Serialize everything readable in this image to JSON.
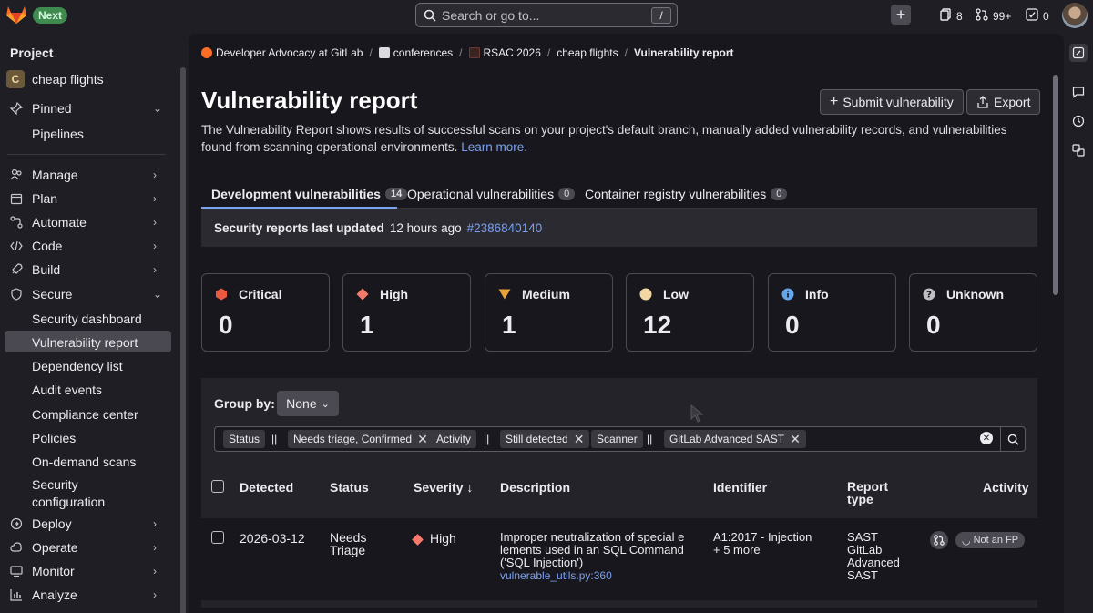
{
  "topbar": {
    "next_badge": "Next",
    "search_placeholder": "Search or go to...",
    "search_shortcut": "/",
    "snippets_count": "8",
    "merge_requests_count": "99+",
    "todos_count": "0"
  },
  "sidebar": {
    "heading": "Project",
    "project_initial": "C",
    "project_name": "cheap flights",
    "pinned": "Pinned",
    "pinned_items": [
      "Pipelines"
    ],
    "manage": "Manage",
    "plan": "Plan",
    "automate": "Automate",
    "code": "Code",
    "build": "Build",
    "secure": "Secure",
    "secure_items": [
      "Security dashboard",
      "Vulnerability report",
      "Dependency list",
      "Audit events",
      "Compliance center",
      "Policies",
      "On-demand scans",
      "Security",
      "configuration"
    ],
    "deploy": "Deploy",
    "operate": "Operate",
    "monitor": "Monitor",
    "analyze": "Analyze"
  },
  "breadcrumb": {
    "items": [
      "Developer Advocacy at GitLab",
      "conferences",
      "RSAC 2026",
      "cheap flights"
    ],
    "current": "Vulnerability report"
  },
  "page": {
    "title": "Vulnerability report",
    "submit_label": "Submit vulnerability",
    "export_label": "Export",
    "description": "The Vulnerability Report shows results of successful scans on your project's default branch, manually added vulnerability records, and vulnerabilities found from scanning operational environments.",
    "learn_more": "Learn more."
  },
  "tabs": [
    {
      "label": "Development vulnerabilities",
      "count": "14"
    },
    {
      "label": "Operational vulnerabilities",
      "count": "0"
    },
    {
      "label": "Container registry vulnerabilities",
      "count": "0"
    }
  ],
  "updated": {
    "label": "Security reports last updated",
    "time": "12 hours ago",
    "pipeline": "#2386840140"
  },
  "severity_cards": [
    {
      "label": "Critical",
      "value": "0",
      "color": "#ec5941"
    },
    {
      "label": "High",
      "value": "1",
      "color": "#f57a6b"
    },
    {
      "label": "Medium",
      "value": "1",
      "color": "#e9a23b"
    },
    {
      "label": "Low",
      "value": "12",
      "color": "#f2d7a2"
    },
    {
      "label": "Info",
      "value": "0",
      "color": "#63a6e9"
    },
    {
      "label": "Unknown",
      "value": "0",
      "color": "#bfbfc3"
    }
  ],
  "filters": {
    "group_by_label": "Group by:",
    "group_by_value": "None",
    "tokens": [
      {
        "key": "Status",
        "op": "||",
        "value": "Needs triage, Confirmed"
      },
      {
        "key": "Activity",
        "op": "||",
        "value": "Still detected"
      },
      {
        "key": "Scanner",
        "op": "||",
        "value": "GitLab Advanced SAST"
      }
    ]
  },
  "table": {
    "headers": {
      "detected": "Detected",
      "status": "Status",
      "severity": "Severity",
      "severity_sort": "↓",
      "description": "Description",
      "identifier": "Identifier",
      "report_type_1": "Report",
      "report_type_2": "type",
      "activity": "Activity"
    },
    "rows": [
      {
        "detected": "2026-03-12",
        "status_1": "Needs",
        "status_2": "Triage",
        "severity": "High",
        "description_1": "Improper neutralization of special e",
        "description_2": "lements used in an SQL Command",
        "description_3": "('SQL Injection')",
        "file": "vulnerable_utils.py:360",
        "identifier": "A1:2017 - Injection",
        "identifier_more": "+ 5 more",
        "report_1": "SAST",
        "report_2": "GitLab",
        "report_3": "Advanced",
        "report_4": "SAST",
        "not_fp": "Not an FP"
      }
    ]
  }
}
